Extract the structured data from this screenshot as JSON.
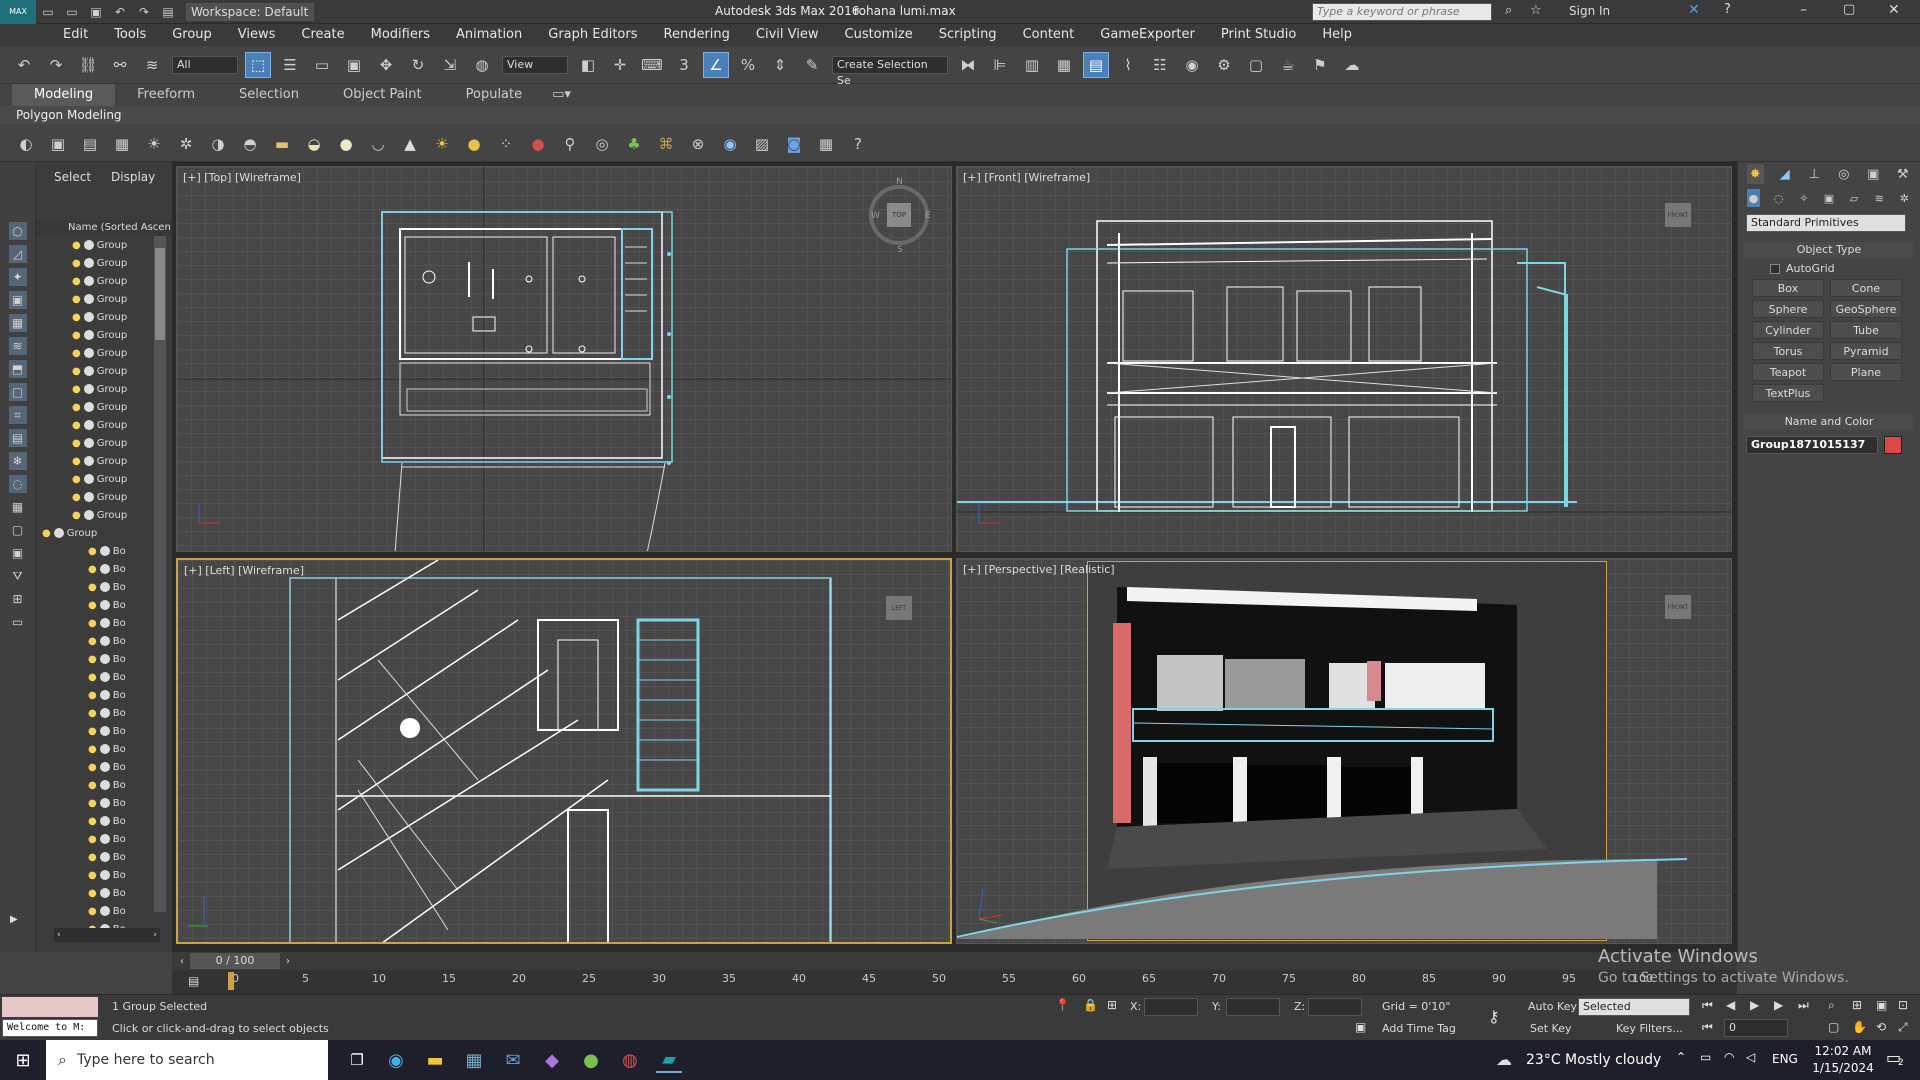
{
  "titlebar": {
    "workspace_label": "Workspace: Default",
    "app_title": "Autodesk 3ds Max 2016",
    "file_name": "rohana lumi.max",
    "search_placeholder": "Type a keyword or phrase",
    "sign_in": "Sign In"
  },
  "menu": [
    "Edit",
    "Tools",
    "Group",
    "Views",
    "Create",
    "Modifiers",
    "Animation",
    "Graph Editors",
    "Rendering",
    "Civil View",
    "Customize",
    "Scripting",
    "Content",
    "GameExporter",
    "Print Studio",
    "Help"
  ],
  "main_toolbar": {
    "selection_filter": "All",
    "ref_coord": "View",
    "create_selection_set": "Create Selection Se"
  },
  "ribbon": {
    "tabs": [
      "Modeling",
      "Freeform",
      "Selection",
      "Object Paint",
      "Populate"
    ],
    "active_tab": "Modeling",
    "sub_label": "Polygon Modeling"
  },
  "scene_explorer": {
    "tabs": [
      "Select",
      "Display"
    ],
    "column_header": "Name (Sorted Ascen",
    "group_rows": [
      "Group",
      "Group",
      "Group",
      "Group",
      "Group",
      "Group",
      "Group",
      "Group",
      "Group",
      "Group",
      "Group",
      "Group",
      "Group",
      "Group",
      "Group",
      "Group",
      "Group"
    ],
    "child_rows": [
      "Bo",
      "Bo",
      "Bo",
      "Bo",
      "Bo",
      "Bo",
      "Bo",
      "Bo",
      "Bo",
      "Bo",
      "Bo",
      "Bo",
      "Bo",
      "Bo",
      "Bo",
      "Bo",
      "Bo",
      "Bo",
      "Bo",
      "Bo",
      "Bo",
      "Bo"
    ]
  },
  "viewports": {
    "top": "[+] [Top] [Wireframe]",
    "front": "[+] [Front] [Wireframe]",
    "left": "[+] [Left] [Wireframe]",
    "perspective": "[+] [Perspective] [Realistic]",
    "cube_top": "TOP",
    "cube_front": "FRONT",
    "cube_left": "LEFT",
    "compass_n": "N",
    "compass_s": "S",
    "compass_w": "W",
    "compass_e": "E"
  },
  "command_panel": {
    "dropdown": "Standard Primitives",
    "object_type_title": "Object Type",
    "autogrid": "AutoGrid",
    "buttons": [
      "Box",
      "Cone",
      "Sphere",
      "GeoSphere",
      "Cylinder",
      "Tube",
      "Torus",
      "Pyramid",
      "Teapot",
      "Plane",
      "TextPlus"
    ],
    "name_color_title": "Name and Color",
    "object_name": "Group1871015137",
    "object_color": "#d84a4a"
  },
  "timeline": {
    "frame_counter": "0 / 100",
    "ticks": [
      "0",
      "5",
      "10",
      "15",
      "20",
      "25",
      "30",
      "35",
      "40",
      "45",
      "50",
      "55",
      "60",
      "65",
      "70",
      "75",
      "80",
      "85",
      "90",
      "95",
      "100"
    ]
  },
  "status": {
    "maxscript_text": "Welcome to M:",
    "selection_count": "1 Group Selected",
    "prompt": "Click or click-and-drag to select objects",
    "x_label": "X:",
    "y_label": "Y:",
    "z_label": "Z:",
    "grid": "Grid = 0'10\"",
    "add_time_tag": "Add Time Tag",
    "auto_key": "Auto Key",
    "set_key": "Set Key",
    "key_mode": "Selected",
    "key_filters": "Key Filters...",
    "frame_value": "0",
    "activate_title": "Activate Windows",
    "activate_sub": "Go to Settings to activate Windows."
  },
  "taskbar": {
    "search_placeholder": "Type here to search",
    "weather": "23°C  Mostly cloudy",
    "language": "ENG",
    "time": "12:02 AM",
    "date": "1/15/2024",
    "notif_count": "2"
  }
}
